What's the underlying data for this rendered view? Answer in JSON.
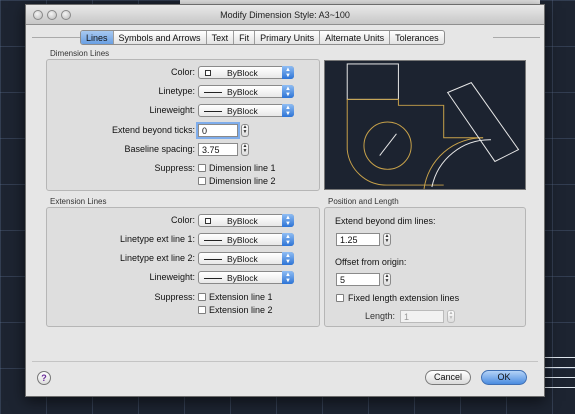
{
  "window": {
    "title": "Modify Dimension Style: A3~100"
  },
  "tabs": [
    {
      "label": "Lines",
      "active": true
    },
    {
      "label": "Symbols and Arrows"
    },
    {
      "label": "Text"
    },
    {
      "label": "Fit"
    },
    {
      "label": "Primary Units"
    },
    {
      "label": "Alternate Units"
    },
    {
      "label": "Tolerances"
    }
  ],
  "dimension_lines": {
    "title": "Dimension Lines",
    "color_label": "Color:",
    "color_value": "ByBlock",
    "linetype_label": "Linetype:",
    "linetype_value": "ByBlock",
    "lineweight_label": "Lineweight:",
    "lineweight_value": "ByBlock",
    "extend_ticks_label": "Extend beyond ticks:",
    "extend_ticks_value": "0",
    "baseline_label": "Baseline spacing:",
    "baseline_value": "3.75",
    "suppress_label": "Suppress:",
    "suppress_1": "Dimension line 1",
    "suppress_2": "Dimension line 2"
  },
  "extension_lines": {
    "title": "Extension Lines",
    "color_label": "Color:",
    "color_value": "ByBlock",
    "linetype1_label": "Linetype ext line 1:",
    "linetype1_value": "ByBlock",
    "linetype2_label": "Linetype ext line 2:",
    "linetype2_value": "ByBlock",
    "lineweight_label": "Lineweight:",
    "lineweight_value": "ByBlock",
    "suppress_label": "Suppress:",
    "suppress_1": "Extension line 1",
    "suppress_2": "Extension line 2"
  },
  "position_length": {
    "title": "Position and Length",
    "extend_dim_label": "Extend beyond dim lines:",
    "extend_dim_value": "1.25",
    "offset_label": "Offset from origin:",
    "offset_value": "5",
    "fixed_label": "Fixed length extension lines",
    "length_label": "Length:",
    "length_value": "1"
  },
  "buttons": {
    "help": "?",
    "cancel": "Cancel",
    "ok": "OK"
  },
  "colors": {
    "accent": "#5f98e0",
    "preview_bg": "#1c2330",
    "preview_yellow": "#c8a24a"
  }
}
